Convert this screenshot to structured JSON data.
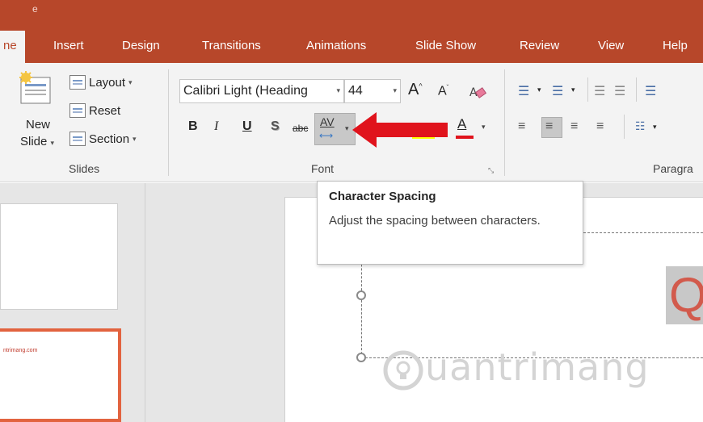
{
  "title_glyph": "e",
  "tabs": [
    {
      "label": "ne"
    },
    {
      "label": "Insert"
    },
    {
      "label": "Design"
    },
    {
      "label": "Transitions"
    },
    {
      "label": "Animations"
    },
    {
      "label": "Slide Show"
    },
    {
      "label": "Review"
    },
    {
      "label": "View"
    },
    {
      "label": "Help"
    }
  ],
  "slides_group": {
    "new_slide_line1": "New",
    "new_slide_line2": "Slide",
    "layout": "Layout",
    "reset": "Reset",
    "section": "Section",
    "label": "Slides"
  },
  "font_group": {
    "font_name": "Calibri Light (Heading",
    "font_size": "44",
    "grow": "A",
    "shrink": "A",
    "bold": "B",
    "italic": "I",
    "underline": "U",
    "shadow": "S",
    "strike": "abc",
    "spacing": "AV",
    "font_color": "A",
    "label": "Font"
  },
  "paragraph_group": {
    "label": "Paragra"
  },
  "tooltip": {
    "title": "Character Spacing",
    "body": "Adjust the spacing between characters."
  },
  "thumbnail_text": "ntrimang.com",
  "slide": {
    "title_char": "Q",
    "watermark": "uantrimang"
  },
  "colors": {
    "accent": "#b7472a",
    "arrow": "#e0131c",
    "thumb_border": "#e2633f"
  }
}
